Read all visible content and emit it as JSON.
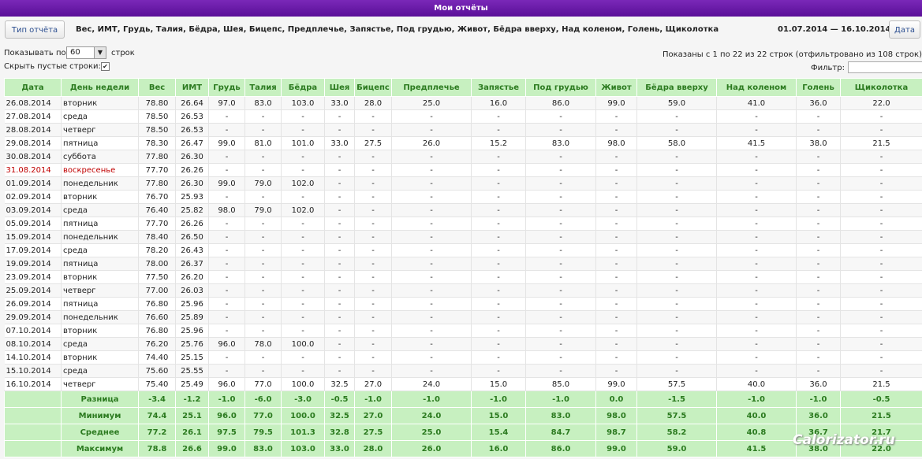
{
  "header": {
    "title": "Мои отчёты"
  },
  "toolbar": {
    "report_type_label": "Тип отчёта",
    "fields_text": "Вес, ИМТ, Грудь, Талия, Бёдра, Шея, Бицепс, Предплечье, Запястье, Под грудью, Живот, Бёдра вверху, Над коленом, Голень, Щиколотка",
    "date_range": "01.07.2014 — 16.10.2014",
    "date_label": "Дата"
  },
  "controls": {
    "show_label": "Показывать по",
    "rows_value": "60",
    "rows_label": "строк",
    "hide_empty_label": "Скрыть пустые строки:",
    "hide_empty_checked": true,
    "info": "Показаны с 1 по 22 из 22 строк (отфильтровано из 108 строк)",
    "filter_label": "Фильтр:",
    "filter_value": ""
  },
  "columns": [
    "Дата",
    "День недели",
    "Вес",
    "ИМТ",
    "Грудь",
    "Талия",
    "Бёдра",
    "Шея",
    "Бицепс",
    "Предплечье",
    "Запястье",
    "Под грудью",
    "Живот",
    "Бёдра вверху",
    "Над коленом",
    "Голень",
    "Щиколотка"
  ],
  "rows": [
    [
      "26.08.2014",
      "вторник",
      "78.80",
      "26.64",
      "97.0",
      "83.0",
      "103.0",
      "33.0",
      "28.0",
      "25.0",
      "16.0",
      "86.0",
      "99.0",
      "59.0",
      "41.0",
      "36.0",
      "22.0"
    ],
    [
      "27.08.2014",
      "среда",
      "78.50",
      "26.53",
      "-",
      "-",
      "-",
      "-",
      "-",
      "-",
      "-",
      "-",
      "-",
      "-",
      "-",
      "-",
      "-"
    ],
    [
      "28.08.2014",
      "четверг",
      "78.50",
      "26.53",
      "-",
      "-",
      "-",
      "-",
      "-",
      "-",
      "-",
      "-",
      "-",
      "-",
      "-",
      "-",
      "-"
    ],
    [
      "29.08.2014",
      "пятница",
      "78.30",
      "26.47",
      "99.0",
      "81.0",
      "101.0",
      "33.0",
      "27.5",
      "26.0",
      "15.2",
      "83.0",
      "98.0",
      "58.0",
      "41.5",
      "38.0",
      "21.5"
    ],
    [
      "30.08.2014",
      "суббота",
      "77.80",
      "26.30",
      "-",
      "-",
      "-",
      "-",
      "-",
      "-",
      "-",
      "-",
      "-",
      "-",
      "-",
      "-",
      "-"
    ],
    [
      "31.08.2014",
      "воскресенье",
      "77.70",
      "26.26",
      "-",
      "-",
      "-",
      "-",
      "-",
      "-",
      "-",
      "-",
      "-",
      "-",
      "-",
      "-",
      "-"
    ],
    [
      "01.09.2014",
      "понедельник",
      "77.80",
      "26.30",
      "99.0",
      "79.0",
      "102.0",
      "-",
      "-",
      "-",
      "-",
      "-",
      "-",
      "-",
      "-",
      "-",
      "-"
    ],
    [
      "02.09.2014",
      "вторник",
      "76.70",
      "25.93",
      "-",
      "-",
      "-",
      "-",
      "-",
      "-",
      "-",
      "-",
      "-",
      "-",
      "-",
      "-",
      "-"
    ],
    [
      "03.09.2014",
      "среда",
      "76.40",
      "25.82",
      "98.0",
      "79.0",
      "102.0",
      "-",
      "-",
      "-",
      "-",
      "-",
      "-",
      "-",
      "-",
      "-",
      "-"
    ],
    [
      "05.09.2014",
      "пятница",
      "77.70",
      "26.26",
      "-",
      "-",
      "-",
      "-",
      "-",
      "-",
      "-",
      "-",
      "-",
      "-",
      "-",
      "-",
      "-"
    ],
    [
      "15.09.2014",
      "понедельник",
      "78.40",
      "26.50",
      "-",
      "-",
      "-",
      "-",
      "-",
      "-",
      "-",
      "-",
      "-",
      "-",
      "-",
      "-",
      "-"
    ],
    [
      "17.09.2014",
      "среда",
      "78.20",
      "26.43",
      "-",
      "-",
      "-",
      "-",
      "-",
      "-",
      "-",
      "-",
      "-",
      "-",
      "-",
      "-",
      "-"
    ],
    [
      "19.09.2014",
      "пятница",
      "78.00",
      "26.37",
      "-",
      "-",
      "-",
      "-",
      "-",
      "-",
      "-",
      "-",
      "-",
      "-",
      "-",
      "-",
      "-"
    ],
    [
      "23.09.2014",
      "вторник",
      "77.50",
      "26.20",
      "-",
      "-",
      "-",
      "-",
      "-",
      "-",
      "-",
      "-",
      "-",
      "-",
      "-",
      "-",
      "-"
    ],
    [
      "25.09.2014",
      "четверг",
      "77.00",
      "26.03",
      "-",
      "-",
      "-",
      "-",
      "-",
      "-",
      "-",
      "-",
      "-",
      "-",
      "-",
      "-",
      "-"
    ],
    [
      "26.09.2014",
      "пятница",
      "76.80",
      "25.96",
      "-",
      "-",
      "-",
      "-",
      "-",
      "-",
      "-",
      "-",
      "-",
      "-",
      "-",
      "-",
      "-"
    ],
    [
      "29.09.2014",
      "понедельник",
      "76.60",
      "25.89",
      "-",
      "-",
      "-",
      "-",
      "-",
      "-",
      "-",
      "-",
      "-",
      "-",
      "-",
      "-",
      "-"
    ],
    [
      "07.10.2014",
      "вторник",
      "76.80",
      "25.96",
      "-",
      "-",
      "-",
      "-",
      "-",
      "-",
      "-",
      "-",
      "-",
      "-",
      "-",
      "-",
      "-"
    ],
    [
      "08.10.2014",
      "среда",
      "76.20",
      "25.76",
      "96.0",
      "78.0",
      "100.0",
      "-",
      "-",
      "-",
      "-",
      "-",
      "-",
      "-",
      "-",
      "-",
      "-"
    ],
    [
      "14.10.2014",
      "вторник",
      "74.40",
      "25.15",
      "-",
      "-",
      "-",
      "-",
      "-",
      "-",
      "-",
      "-",
      "-",
      "-",
      "-",
      "-",
      "-"
    ],
    [
      "15.10.2014",
      "среда",
      "75.60",
      "25.55",
      "-",
      "-",
      "-",
      "-",
      "-",
      "-",
      "-",
      "-",
      "-",
      "-",
      "-",
      "-",
      "-"
    ],
    [
      "16.10.2014",
      "четверг",
      "75.40",
      "25.49",
      "96.0",
      "77.0",
      "100.0",
      "32.5",
      "27.0",
      "24.0",
      "15.0",
      "85.0",
      "99.0",
      "57.5",
      "40.0",
      "36.0",
      "21.5"
    ]
  ],
  "summary": [
    {
      "label": "Разница",
      "values": [
        "-3.4",
        "-1.2",
        "-1.0",
        "-6.0",
        "-3.0",
        "-0.5",
        "-1.0",
        "-1.0",
        "-1.0",
        "-1.0",
        "0.0",
        "-1.5",
        "-1.0",
        "-1.0",
        "-0.5"
      ]
    },
    {
      "label": "Минимум",
      "values": [
        "74.4",
        "25.1",
        "96.0",
        "77.0",
        "100.0",
        "32.5",
        "27.0",
        "24.0",
        "15.0",
        "83.0",
        "98.0",
        "57.5",
        "40.0",
        "36.0",
        "21.5"
      ]
    },
    {
      "label": "Среднее",
      "values": [
        "77.2",
        "26.1",
        "97.5",
        "79.5",
        "101.3",
        "32.8",
        "27.5",
        "25.0",
        "15.4",
        "84.7",
        "98.7",
        "58.2",
        "40.8",
        "36.7",
        "21.7"
      ]
    },
    {
      "label": "Максимум",
      "values": [
        "78.8",
        "26.6",
        "99.0",
        "83.0",
        "103.0",
        "33.0",
        "28.0",
        "26.0",
        "16.0",
        "86.0",
        "99.0",
        "59.0",
        "41.5",
        "38.0",
        "22.0"
      ]
    }
  ],
  "watermark": "Calorizator.ru"
}
